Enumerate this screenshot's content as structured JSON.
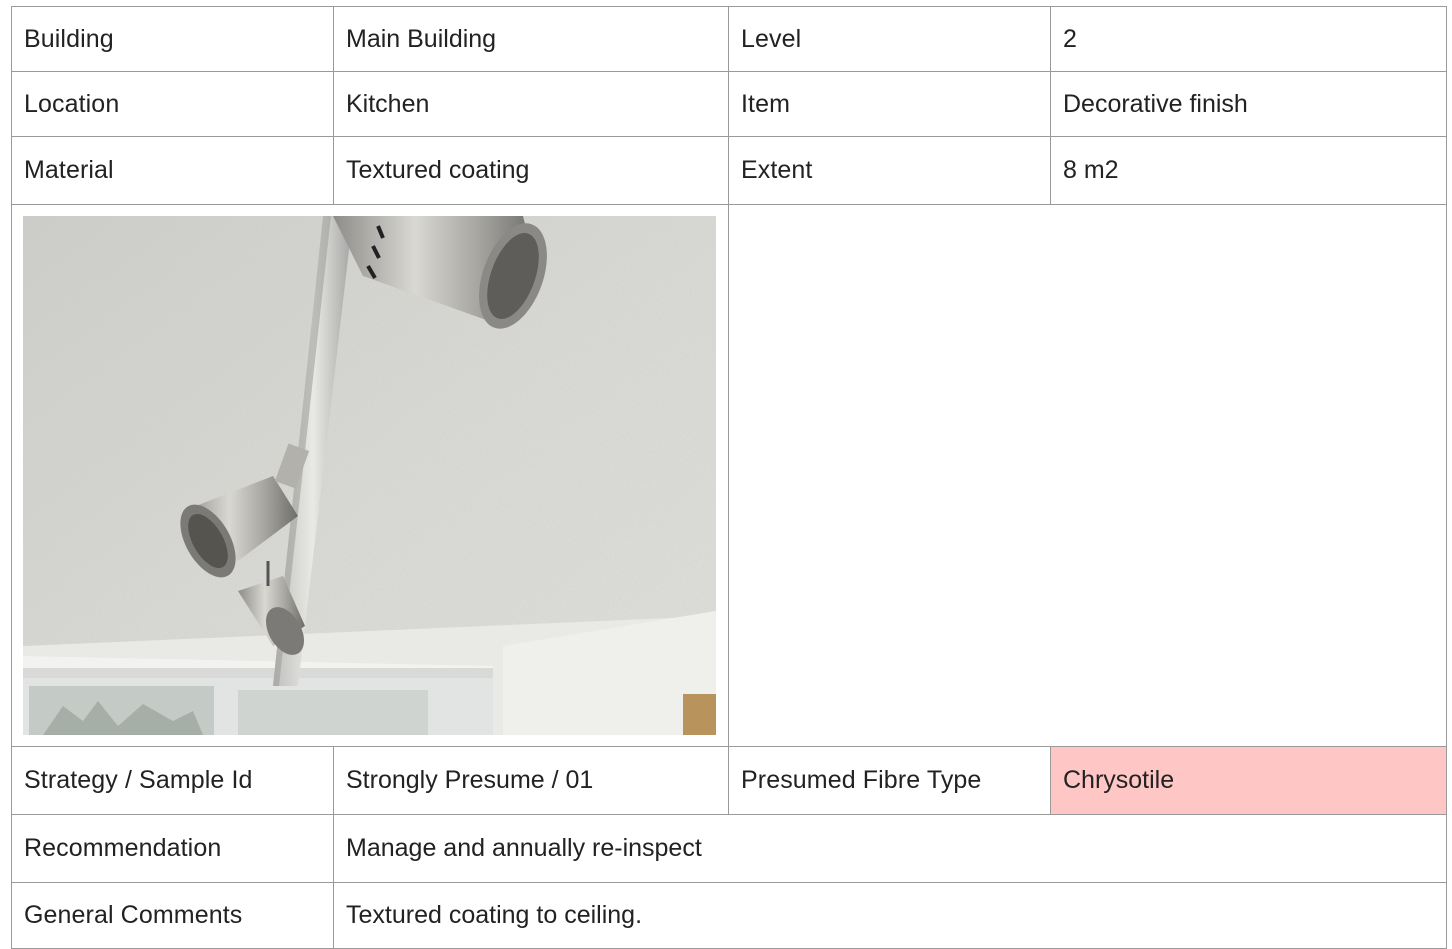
{
  "rows": {
    "building": {
      "label": "Building",
      "value": "Main Building"
    },
    "level": {
      "label": "Level",
      "value": "2"
    },
    "location": {
      "label": "Location",
      "value": "Kitchen"
    },
    "item": {
      "label": "Item",
      "value": "Decorative finish"
    },
    "material": {
      "label": "Material",
      "value": "Textured coating"
    },
    "extent": {
      "label": "Extent",
      "value": "8 m2"
    },
    "strategy": {
      "label": "Strategy / Sample Id",
      "value": "Strongly Presume / 01"
    },
    "fibre": {
      "label": "Presumed Fibre Type",
      "value": "Chrysotile",
      "highlight_color": "#ffc6c6"
    },
    "recommendation": {
      "label": "Recommendation",
      "value": "Manage and annually re-inspect"
    },
    "comments": {
      "label": "General Comments",
      "value": "Textured coating to ceiling."
    }
  },
  "photo": {
    "subject": "textured ceiling with spotlight track fitting"
  }
}
